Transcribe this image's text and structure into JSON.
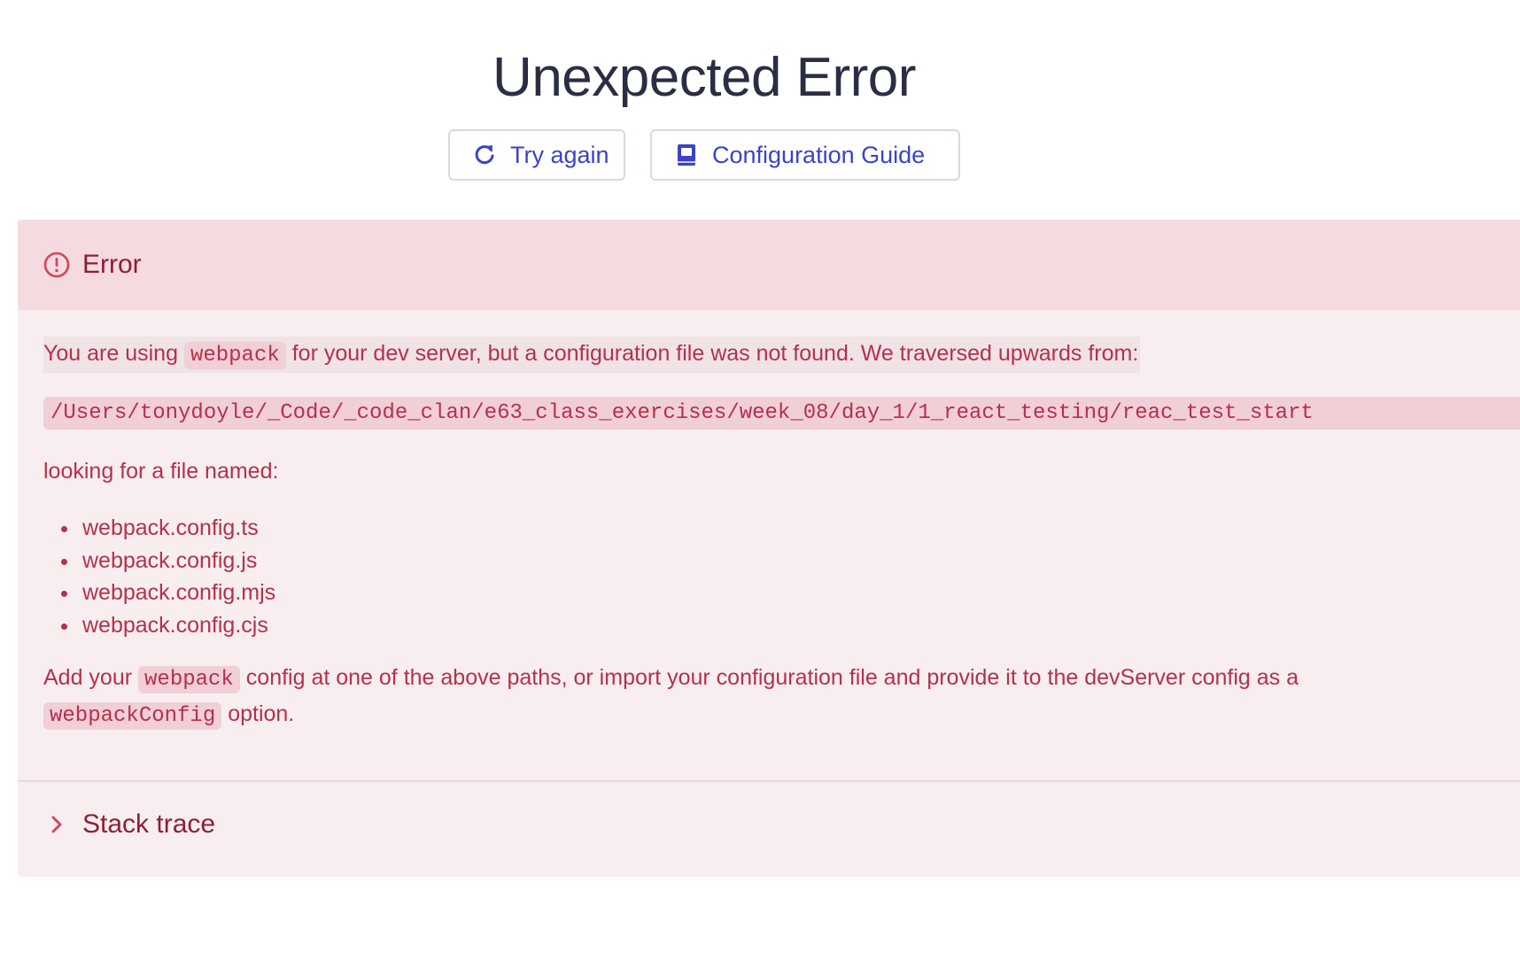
{
  "title": "Unexpected Error",
  "actions": {
    "try_again": "Try again",
    "config_guide": "Configuration Guide"
  },
  "error": {
    "heading": "Error",
    "message_part1": "You are using",
    "message_code1": "webpack",
    "message_part2": "for your dev server, but a configuration file was not found. We traversed upwards from:",
    "path": "/Users/tonydoyle/_Code/_code_clan/e63_class_exercises/week_08/day_1/1_react_testing/reac_test_start",
    "looking_for": "looking for a file named:",
    "files": [
      "webpack.config.ts",
      "webpack.config.js",
      "webpack.config.mjs",
      "webpack.config.cjs"
    ],
    "hint_part1": "Add your",
    "hint_code1": "webpack",
    "hint_part2": "config at one of the above paths, or import your configuration file and provide it to the devServer config as a",
    "hint_code2": "webpackConfig",
    "hint_part3": "option."
  },
  "stack_trace": {
    "label": "Stack trace"
  },
  "icons": {
    "retry": "refresh-icon",
    "guide": "book-icon",
    "error": "alert-circle-icon",
    "expand": "chevron-right-icon"
  },
  "colors": {
    "title": "#2b2e43",
    "accent": "#3b43c8",
    "error_text": "#b6304c",
    "error_heading": "#8d1f34",
    "panel_bg": "#f8eef0",
    "header_bg": "#f5dadf"
  }
}
